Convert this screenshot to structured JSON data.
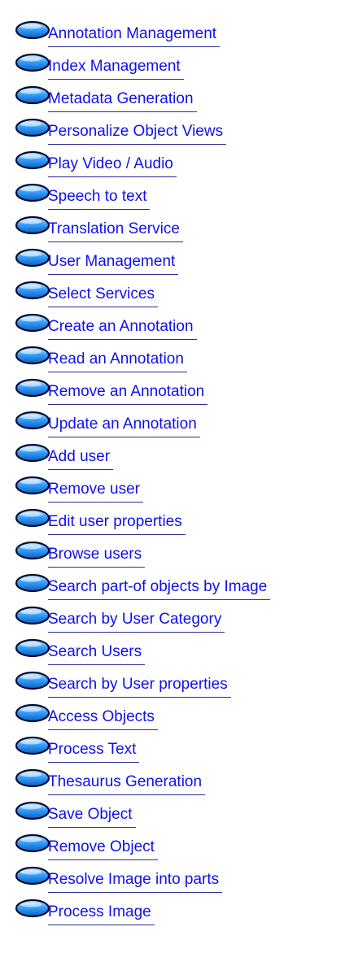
{
  "icon": "use-case-ellipse-icon",
  "colors": {
    "link": "#1010ee",
    "underline": "#2a2a9a",
    "ellipse_light": "#cfeaff",
    "ellipse_mid": "#36a0ff",
    "ellipse_dark": "#0a5fb8",
    "ellipse_outline": "#050a2e"
  },
  "use_cases": [
    "Annotation Management",
    "Index Management",
    "Metadata Generation",
    "Personalize Object Views",
    "Play Video / Audio",
    "Speech to text",
    "Translation Service",
    "User Management",
    "Select Services",
    "Create an Annotation",
    "Read an Annotation",
    "Remove an Annotation",
    "Update an Annotation",
    "Add user",
    "Remove user",
    "Edit user properties",
    "Browse users",
    "Search part-of objects by Image",
    "Search by User Category",
    "Search Users",
    "Search by User properties",
    "Access Objects",
    "Process Text",
    "Thesaurus Generation",
    "Save Object",
    "Remove Object",
    "Resolve Image into parts",
    "Process Image"
  ]
}
